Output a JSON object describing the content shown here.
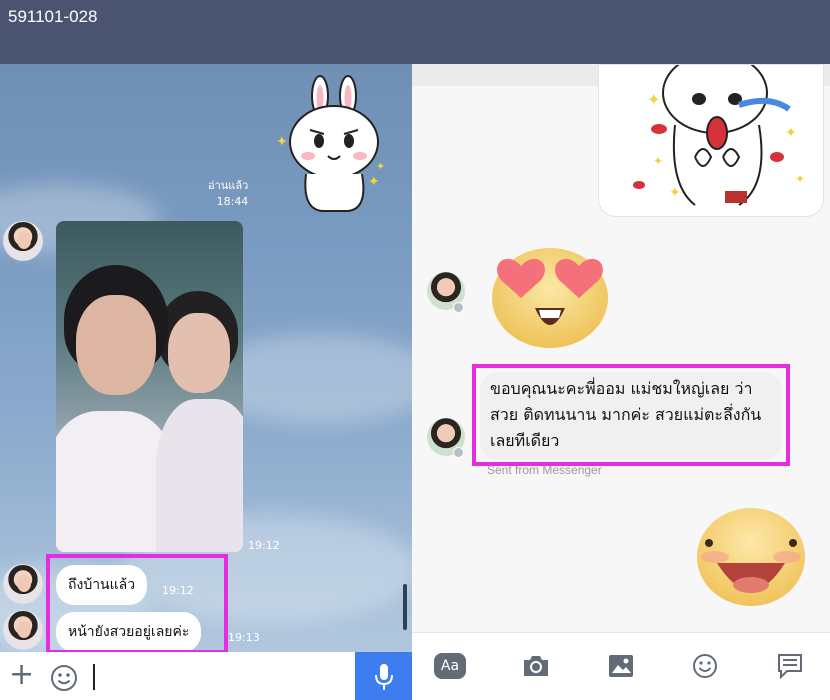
{
  "window": {
    "title": "591101-028"
  },
  "line_chat": {
    "read_label": "อ่านแล้ว",
    "read_time": "18:44",
    "photo_time": "19:12",
    "messages": [
      {
        "text": "ถึงบ้านแล้ว",
        "time": "19:12"
      },
      {
        "text": "หน้ายังสวยอยู่เลยค่ะ",
        "time": "19:13"
      }
    ],
    "input": {
      "plus_label": "+"
    }
  },
  "messenger": {
    "message": "ขอบคุณนะคะพี่ออม แม่ชมใหญ่เลย ว่าสวย ติดทนนาน มากค่ะ สวยแม่ตะลึ่งกันเลยทีเดียว",
    "sent_from": "Sent from Messenger",
    "toolbar": {
      "aa_label": "Aa"
    }
  },
  "colors": {
    "header_bg": "#4a5470",
    "highlight": "#e62ce0",
    "mic_button": "#3d7df0",
    "emoji_yellow": "#f6d97a",
    "heart": "#f4707a"
  }
}
